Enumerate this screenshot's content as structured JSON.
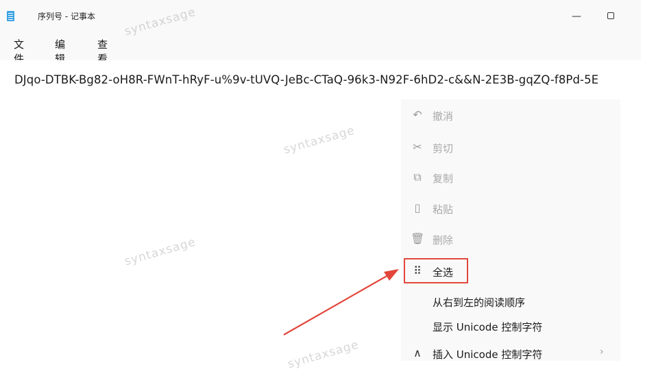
{
  "window": {
    "title": "序列号 - 记事本",
    "icon": "notepad-icon",
    "controls": {
      "minimize": "—"
    }
  },
  "menu": [
    "文件",
    "编辑",
    "查看"
  ],
  "document": {
    "text": "DJqo-DTBK-Bg82-oH8R-FWnT-hRyF-u%9v-tUVQ-JeBc-CTaQ-96k3-N92F-6hD2-c&&N-2E3B-gqZQ-f8Pd-5E"
  },
  "context_menu": {
    "items": [
      {
        "label": "撤消",
        "icon": "undo-icon",
        "enabled": false
      },
      {
        "label": "剪切",
        "icon": "scissors-icon",
        "enabled": false
      },
      {
        "label": "复制",
        "icon": "copy-icon",
        "enabled": false
      },
      {
        "label": "粘贴",
        "icon": "paste-icon",
        "enabled": false
      },
      {
        "label": "删除",
        "icon": "trash-icon",
        "enabled": false
      },
      {
        "label": "全选",
        "icon": "select-all-icon",
        "enabled": true,
        "highlighted": true
      },
      {
        "label": "从右到左的阅读顺序",
        "enabled": true
      },
      {
        "label": "显示 Unicode 控制字符",
        "enabled": true
      },
      {
        "label": "插入 Unicode 控制字符",
        "icon": "caret-up-icon",
        "enabled": true,
        "has_submenu": true
      }
    ]
  },
  "watermark": "syntaxsage",
  "annotation": {
    "highlight_color": "#e2463b",
    "arrow_color": "#e2463b"
  }
}
